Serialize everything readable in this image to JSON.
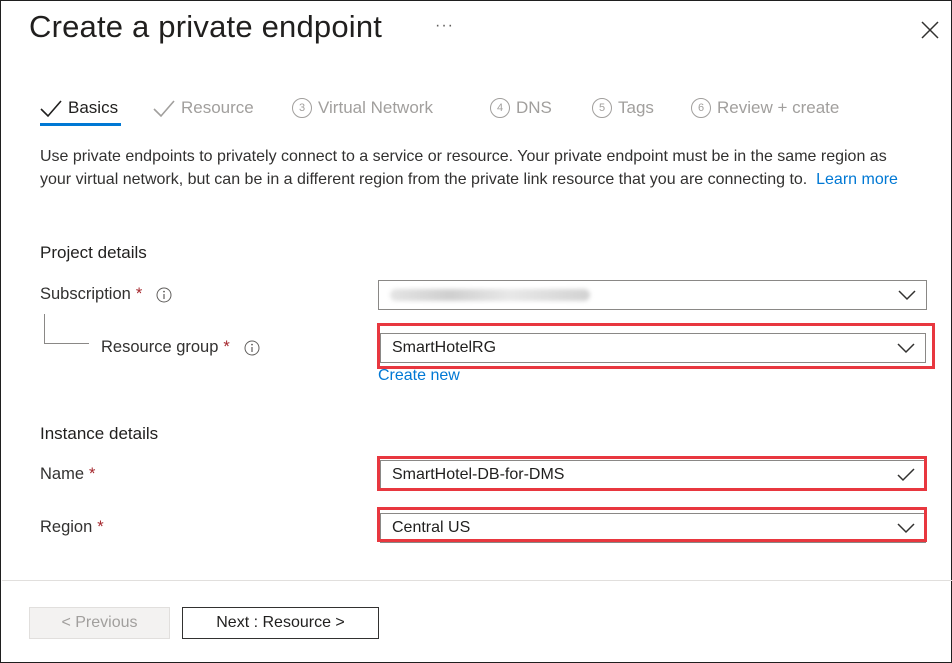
{
  "header": {
    "title": "Create a private endpoint",
    "more_label": "···"
  },
  "tabs": [
    {
      "label": "Basics",
      "state": "completed-active"
    },
    {
      "label": "Resource",
      "state": "completed"
    },
    {
      "label": "Virtual Network",
      "number": "3"
    },
    {
      "label": "DNS",
      "number": "4"
    },
    {
      "label": "Tags",
      "number": "5"
    },
    {
      "label": "Review + create",
      "number": "6"
    }
  ],
  "description": {
    "text": "Use private endpoints to privately connect to a service or resource. Your private endpoint must be in the same region as your virtual network, but can be in a different region from the private link resource that you are connecting to.",
    "learn_more": "Learn more"
  },
  "project_details": {
    "title": "Project details",
    "subscription_label": "Subscription",
    "resource_group_label": "Resource group",
    "resource_group_value": "SmartHotelRG",
    "create_new": "Create new"
  },
  "instance_details": {
    "title": "Instance details",
    "name_label": "Name",
    "name_value": "SmartHotel-DB-for-DMS",
    "region_label": "Region",
    "region_value": "Central US"
  },
  "required_marker": "*",
  "footer": {
    "previous_label": "< Previous",
    "next_label": "Next : Resource >"
  },
  "colors": {
    "accent": "#0078d4",
    "required": "#a4262c",
    "highlight": "#e8373f"
  }
}
